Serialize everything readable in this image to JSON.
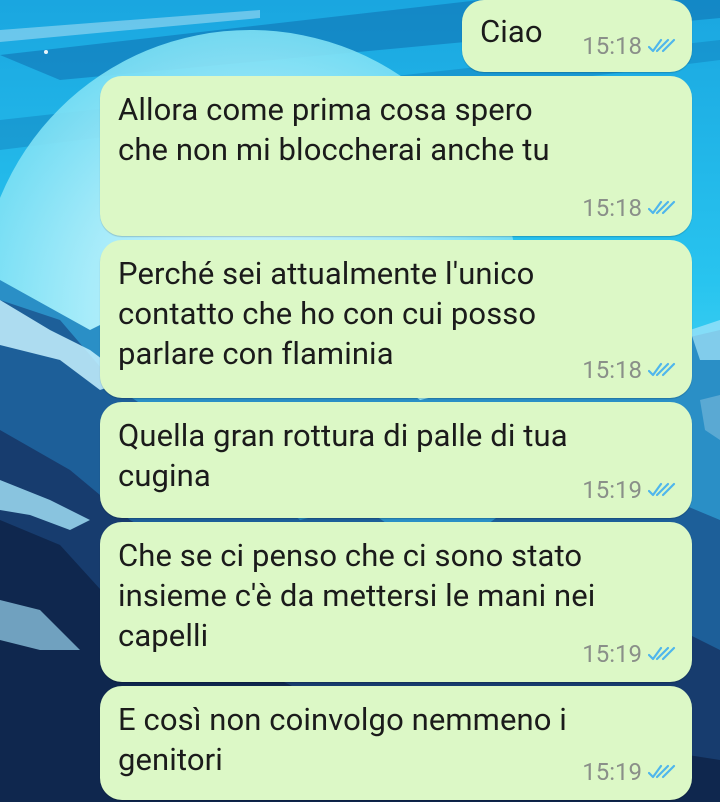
{
  "colors": {
    "bubble": "#dcf8c6",
    "text": "#1b1b1b",
    "time": "#8a8f89",
    "read_ticks": "#4fb6ec"
  },
  "messages": [
    {
      "text": "Ciao",
      "time": "15:18",
      "status": "read-double-check-icon"
    },
    {
      "text": "Allora come prima cosa spero\nche non mi bloccherai anche tu",
      "time": "15:18",
      "status": "read-double-check-icon"
    },
    {
      "text": "Perché sei attualmente l'unico\ncontatto che ho con cui posso\nparlare con flaminia",
      "time": "15:18",
      "status": "read-double-check-icon"
    },
    {
      "text": "Quella gran rottura di palle di tua\ncugina",
      "time": "15:19",
      "status": "read-double-check-icon"
    },
    {
      "text": "Che se ci penso che ci sono stato\ninsieme c'è da mettersi le mani nei\ncapelli",
      "time": "15:19",
      "status": "read-double-check-icon"
    },
    {
      "text": "E così non coinvolgo nemmeno i\ngenitori",
      "time": "15:19",
      "status": "read-double-check-icon"
    }
  ]
}
